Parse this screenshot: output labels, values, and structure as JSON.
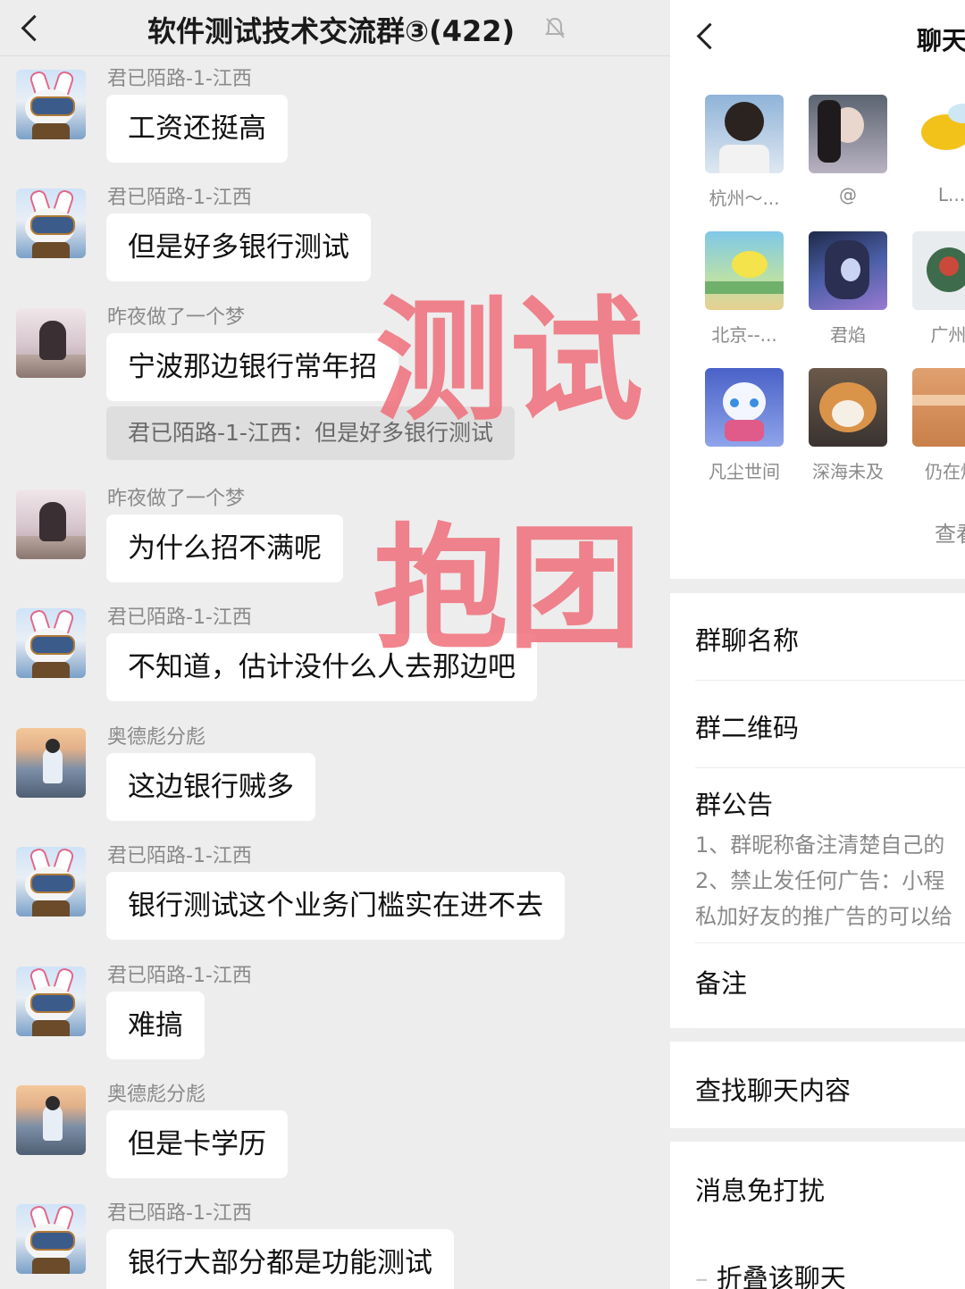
{
  "chat": {
    "title": "软件测试技术交流群③(422)",
    "messages": [
      {
        "sender": "君已陌路-1-江西",
        "text": "工资还挺高",
        "avatar": "rabbit-goggles-avatar"
      },
      {
        "sender": "君已陌路-1-江西",
        "text": "但是好多银行测试",
        "avatar": "rabbit-goggles-avatar"
      },
      {
        "sender": "昨夜做了一个梦",
        "text": "宁波那边银行常年招",
        "avatar": "girl-in-field-avatar",
        "quote": "君已陌路-1-江西：但是好多银行测试"
      },
      {
        "sender": "昨夜做了一个梦",
        "text": "为什么招不满呢",
        "avatar": "girl-in-field-avatar"
      },
      {
        "sender": "君已陌路-1-江西",
        "text": "不知道，估计没什么人去那边吧",
        "avatar": "rabbit-goggles-avatar"
      },
      {
        "sender": "奥德彪分彪",
        "text": "这边银行贼多",
        "avatar": "mountain-person-avatar"
      },
      {
        "sender": "君已陌路-1-江西",
        "text": "银行测试这个业务门槛实在进不去",
        "avatar": "rabbit-goggles-avatar"
      },
      {
        "sender": "君已陌路-1-江西",
        "text": "难搞",
        "avatar": "rabbit-goggles-avatar"
      },
      {
        "sender": "奥德彪分彪",
        "text": "但是卡学历",
        "avatar": "mountain-person-avatar"
      },
      {
        "sender": "君已陌路-1-江西",
        "text": "银行大部分都是功能测试",
        "avatar": "rabbit-goggles-avatar"
      }
    ]
  },
  "watermark": {
    "line1": "测试",
    "line2": "抱团"
  },
  "info": {
    "title": "聊天",
    "members": [
      {
        "name": "杭州～..."
      },
      {
        "name": "@"
      },
      {
        "name": "L..."
      },
      {
        "name": "北京--..."
      },
      {
        "name": "君焰"
      },
      {
        "name": "广州-"
      },
      {
        "name": "凡尘世间"
      },
      {
        "name": "深海未及"
      },
      {
        "name": "仍在燃"
      }
    ],
    "view_more": "查看",
    "group_name_label": "群聊名称",
    "qr_label": "群二维码",
    "notice_label": "群公告",
    "notice_lines": [
      "1、群昵称备注清楚自己的",
      "2、禁止发任何广告：小程",
      "私加好友的推广告的可以给"
    ],
    "remark_label": "备注",
    "search_label": "查找聊天内容",
    "mute_label": "消息免打扰",
    "fold_label": "折叠该聊天"
  }
}
